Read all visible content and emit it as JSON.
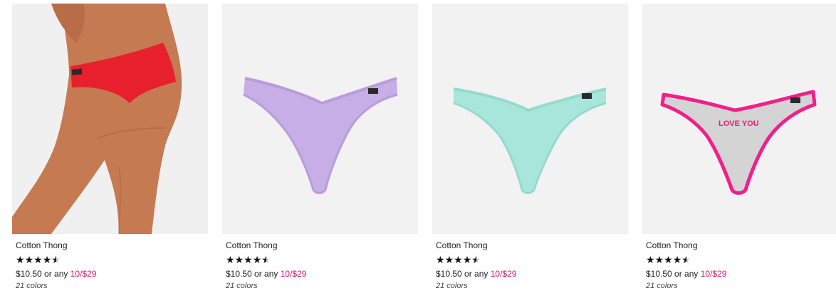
{
  "products": [
    {
      "name": "Cotton Thong",
      "rating": 4.5,
      "price": "$10.50",
      "price_connector": "or any",
      "promo": "10/$29",
      "colors": "21 colors",
      "image": "model-wearing-red-thong"
    },
    {
      "name": "Cotton Thong",
      "rating": 4.5,
      "price": "$10.50",
      "price_connector": "or any",
      "promo": "10/$29",
      "colors": "21 colors",
      "image": "lavender-ribbed-thong"
    },
    {
      "name": "Cotton Thong",
      "rating": 4.5,
      "price": "$10.50",
      "price_connector": "or any",
      "promo": "10/$29",
      "colors": "21 colors",
      "image": "mint-ribbed-thong"
    },
    {
      "name": "Cotton Thong",
      "rating": 4.5,
      "price": "$10.50",
      "price_connector": "or any",
      "promo": "10/$29",
      "colors": "21 colors",
      "image": "grey-pink-love-you-thong",
      "print_text": "LOVE YOU"
    }
  ],
  "colors": {
    "promo": "#d51a6b",
    "star": "#111111",
    "star_empty": "#c8c8c8",
    "image_bg": "#f2f2f2"
  }
}
